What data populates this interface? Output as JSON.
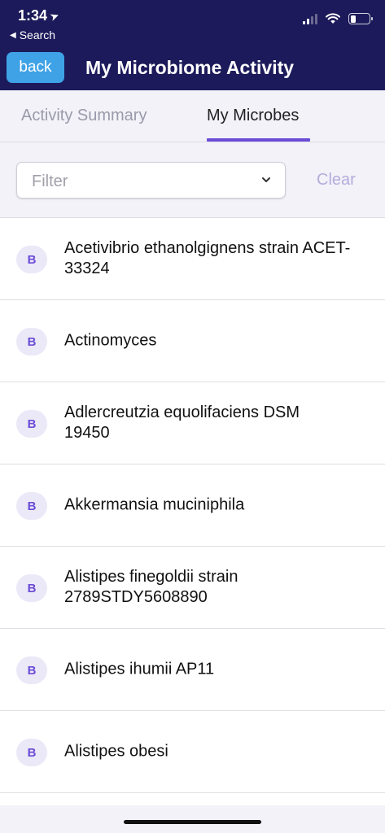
{
  "status_bar": {
    "time": "1:34",
    "back_app": "Search"
  },
  "header": {
    "back_label": "back",
    "title": "My Microbiome Activity",
    "background_color": "#1c1a5a",
    "back_button_color": "#3fa2e6"
  },
  "tabs": [
    {
      "label": "Activity Summary",
      "active": false
    },
    {
      "label": "My Microbes",
      "active": true
    }
  ],
  "filter": {
    "placeholder": "Filter",
    "clear_label": "Clear"
  },
  "accent_color": "#6b4cd6",
  "microbes": [
    {
      "badge": "B",
      "name": "Acetivibrio ethanolgignens strain ACET-33324"
    },
    {
      "badge": "B",
      "name": "Actinomyces"
    },
    {
      "badge": "B",
      "name": "Adlercreutzia equolifaciens DSM 19450"
    },
    {
      "badge": "B",
      "name": "Akkermansia muciniphila"
    },
    {
      "badge": "B",
      "name": "Alistipes finegoldii strain 2789STDY5608890"
    },
    {
      "badge": "B",
      "name": "Alistipes ihumii AP11"
    },
    {
      "badge": "B",
      "name": "Alistipes obesi"
    }
  ]
}
